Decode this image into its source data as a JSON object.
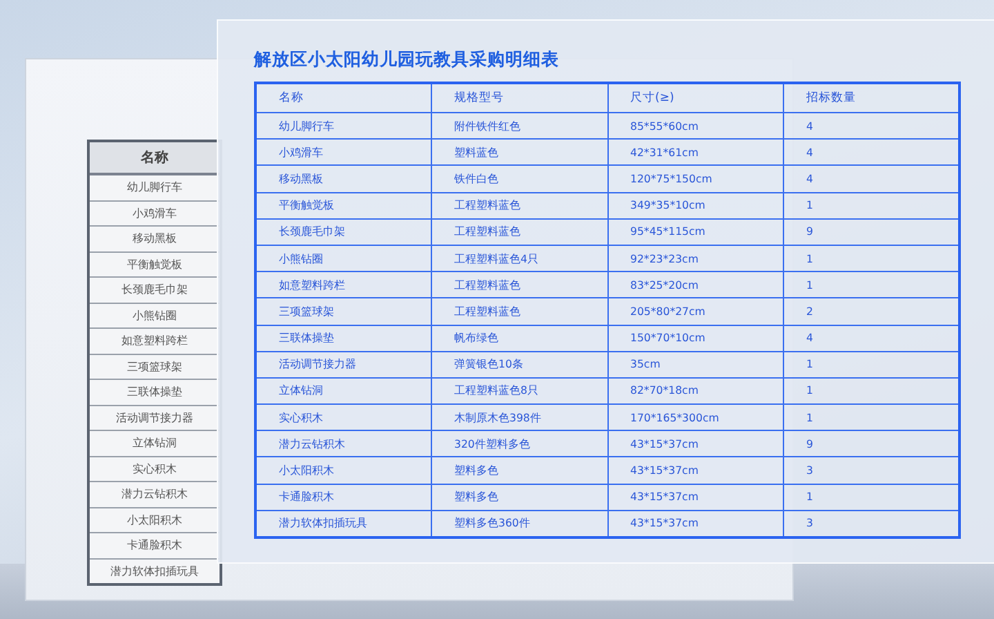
{
  "back_panel": {
    "column_header": "名称",
    "names": [
      "幼儿脚行车",
      "小鸡滑车",
      "移动黑板",
      "平衡触觉板",
      "长颈鹿毛巾架",
      "小熊钻圈",
      "如意塑料跨栏",
      "三项篮球架",
      "三联体操垫",
      "活动调节接力器",
      "立体钻洞",
      "实心积木",
      "潜力云钻积木",
      "小太阳积木",
      "卡通脸积木",
      "潜力软体扣插玩具"
    ]
  },
  "front_panel": {
    "title": "解放区小太阳幼儿园玩教具采购明细表",
    "columns": [
      "名称",
      "规格型号",
      "尺寸(≥)",
      "招标数量"
    ],
    "rows": [
      [
        "幼儿脚行车",
        "附件铁件红色",
        "85*55*60cm",
        "4"
      ],
      [
        "小鸡滑车",
        "塑料蓝色",
        "42*31*61cm",
        "4"
      ],
      [
        "移动黑板",
        "铁件白色",
        "120*75*150cm",
        "4"
      ],
      [
        "平衡触觉板",
        "工程塑料蓝色",
        "349*35*10cm",
        "1"
      ],
      [
        "长颈鹿毛巾架",
        "工程塑料蓝色",
        "95*45*115cm",
        "9"
      ],
      [
        "小熊钻圈",
        "工程塑料蓝色4只",
        "92*23*23cm",
        "1"
      ],
      [
        "如意塑料跨栏",
        "工程塑料蓝色",
        "83*25*20cm",
        "1"
      ],
      [
        "三项篮球架",
        "工程塑料蓝色",
        "205*80*27cm",
        "2"
      ],
      [
        "三联体操垫",
        "帆布绿色",
        "150*70*10cm",
        "4"
      ],
      [
        "活动调节接力器",
        "弹簧银色10条",
        "35cm",
        "1"
      ],
      [
        "立体钻洞",
        "工程塑料蓝色8只",
        "82*70*18cm",
        "1"
      ],
      [
        "实心积木",
        "木制原木色398件",
        "170*165*300cm",
        "1"
      ],
      [
        "潜力云钻积木",
        "320件塑料多色",
        "43*15*37cm",
        "9"
      ],
      [
        "小太阳积木",
        "塑料多色",
        "43*15*37cm",
        "3"
      ],
      [
        "卡通脸积木",
        "塑料多色",
        "43*15*37cm",
        "1"
      ],
      [
        "潜力软体扣插玩具",
        "塑料多色360件",
        "43*15*37cm",
        "3"
      ]
    ]
  }
}
